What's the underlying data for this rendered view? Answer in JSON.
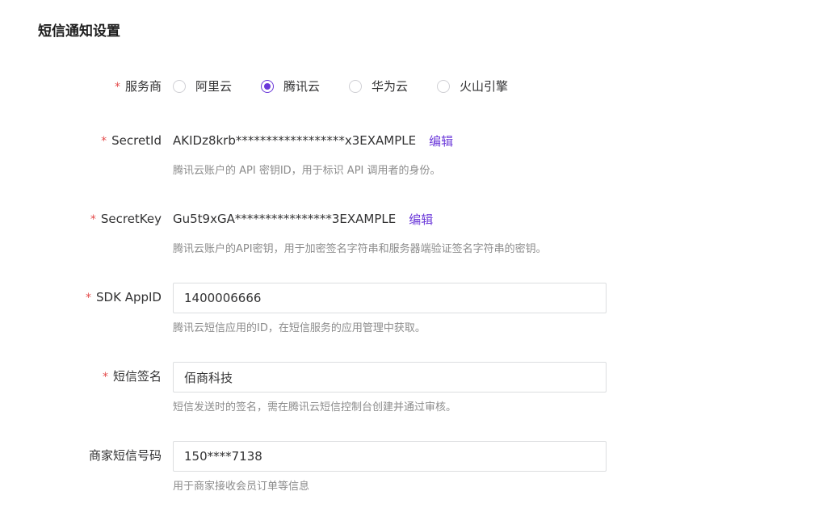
{
  "page": {
    "title": "短信通知设置"
  },
  "provider": {
    "required_mark": "*",
    "label": "服务商",
    "options": [
      "阿里云",
      "腾讯云",
      "华为云",
      "火山引擎"
    ],
    "selected": "腾讯云"
  },
  "secret_id": {
    "required_mark": "*",
    "label": "SecretId",
    "value": "AKIDz8krb******************x3EXAMPLE",
    "edit_label": "编辑",
    "help": "腾讯云账户的 API 密钥ID，用于标识 API 调用者的身份。"
  },
  "secret_key": {
    "required_mark": "*",
    "label": "SecretKey",
    "value": "Gu5t9xGA****************3EXAMPLE",
    "edit_label": "编辑",
    "help": "腾讯云账户的API密钥，用于加密签名字符串和服务器端验证签名字符串的密钥。"
  },
  "sdk_appid": {
    "required_mark": "*",
    "label": "SDK AppID",
    "value": "1400006666",
    "help": "腾讯云短信应用的ID，在短信服务的应用管理中获取。"
  },
  "sms_signature": {
    "required_mark": "*",
    "label": "短信签名",
    "value": "佰商科技",
    "help": "短信发送时的签名，需在腾讯云短信控制台创建并通过审核。"
  },
  "merchant_phone": {
    "label": "商家短信号码",
    "value": "150****7138",
    "help": "用于商家接收会员订单等信息"
  },
  "colors": {
    "accent": "#6b38d9",
    "required": "#e44b4b",
    "help_text": "#8c8c8c"
  }
}
